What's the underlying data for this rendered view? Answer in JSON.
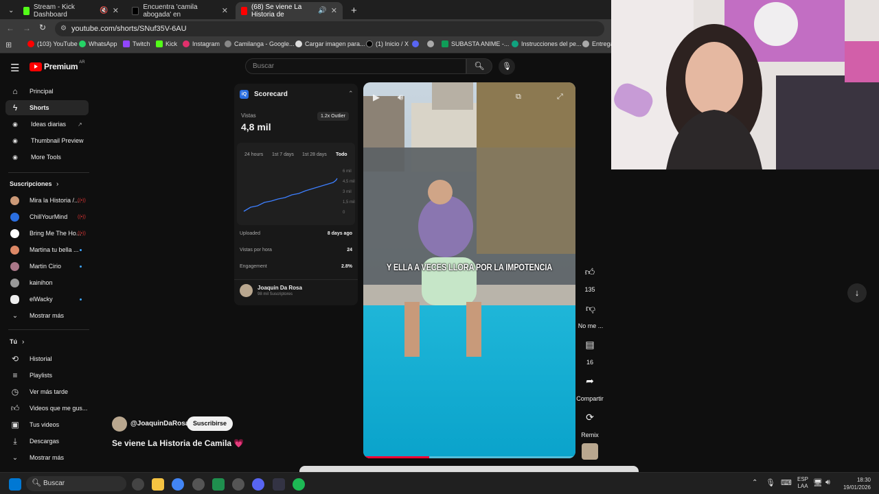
{
  "browser": {
    "tabs": [
      {
        "label": "Stream - Kick Dashboard",
        "color": "#53fc18"
      },
      {
        "label": "Encuentra 'camila abogada' en",
        "color": "#111111"
      },
      {
        "label": "(68) Se viene La Historia de",
        "color": "#ff0000"
      }
    ],
    "url": "youtube.com/shorts/SNuf35V-6AU",
    "bookmarks": [
      "(103) YouTube",
      "WhatsApp",
      "Twitch",
      "Kick",
      "Instagram",
      "Camilanga - Google...",
      "Cargar imagen para...",
      "(1) Inicio / X",
      "SUBASTA ANIME -...",
      "Instrucciones del pe...",
      "Entrega"
    ]
  },
  "youtube": {
    "logo_text": "Premium",
    "logo_sup": "AR",
    "search_placeholder": "Buscar",
    "nav": [
      "Principal",
      "Shorts",
      "Ideas diarias",
      "Thumbnail Preview",
      "More Tools"
    ],
    "subs_title": "Suscripciones",
    "subs": [
      "Mira la Historia /...",
      "ChillYourMind",
      "Bring Me The Ho...",
      "Martina tu bella ...",
      "Martin Cirio",
      "kainihon",
      "elWacky"
    ],
    "show_more": "Mostrar más",
    "you_title": "Tú",
    "you_items": [
      "Historial",
      "Playlists",
      "Ver más tarde",
      "Videos que me gus...",
      "Tus videos",
      "Descargas"
    ],
    "show_more2": "Mostrar más"
  },
  "scorecard": {
    "title": "Scorecard",
    "views_label": "Vistas",
    "views_value": "4,8 mil",
    "outlier": "1.2x Outlier",
    "ranges": [
      "24 hours",
      "1st 7 days",
      "1st 28 days",
      "Todo"
    ],
    "yticks": [
      "6 mil",
      "4,5 mil",
      "3 mil",
      "1,5 mil",
      "0"
    ],
    "uploaded_label": "Uploaded",
    "uploaded_value": "8 days ago",
    "vph_label": "Vistas por hora",
    "vph_value": "24",
    "eng_label": "Engagement",
    "eng_value": "2.8%",
    "channel_name": "Joaquin Da Rosa",
    "channel_subs": "98 mil Suscriptores"
  },
  "video": {
    "caption": "Y ELLA A VECES LLORA POR LA IMPOTENCIA",
    "channel_handle": "@JoaquinDaRosa",
    "subscribe_label": "Suscribirse",
    "title": "Se viene La Historia de Camila 💗",
    "likes": "135",
    "dislike_label": "No me ...",
    "comments": "16",
    "share_label": "Compartir",
    "remix_label": "Remix"
  },
  "taskbar": {
    "search": "Buscar",
    "lang": "ESP",
    "lang2": "LAA",
    "time": "18:30",
    "date": "19/01/2026"
  }
}
